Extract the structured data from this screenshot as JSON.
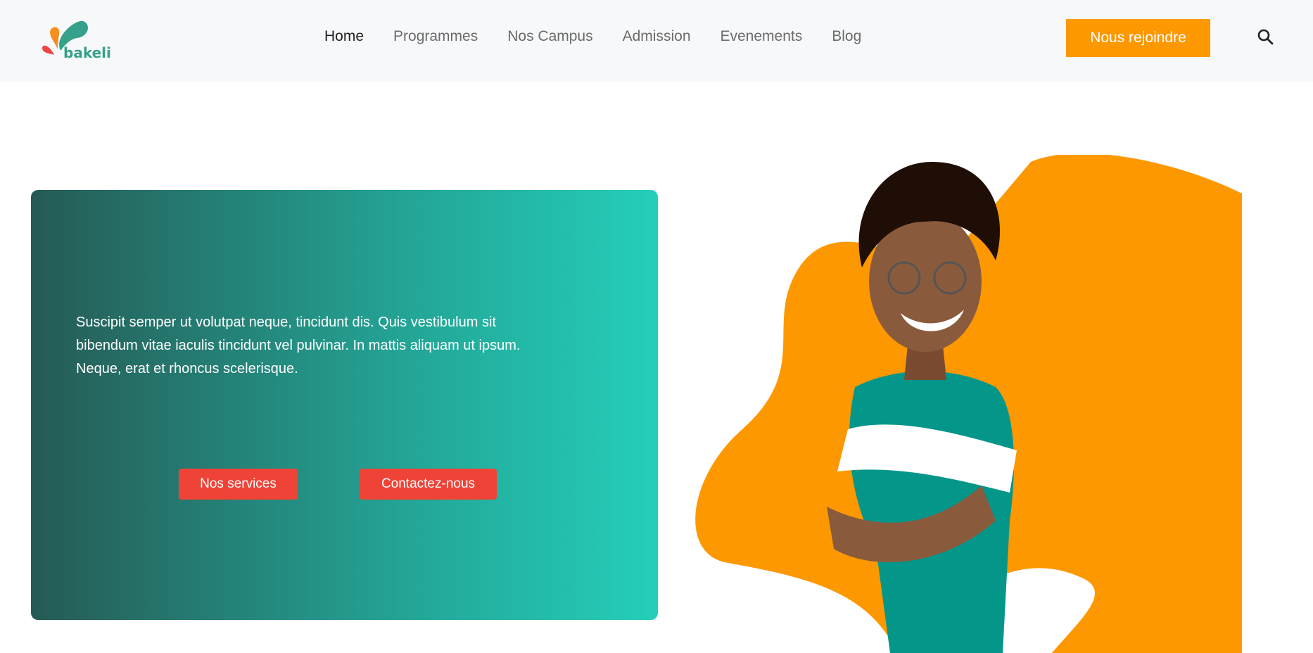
{
  "header": {
    "logo_text": "bakeli",
    "nav": [
      "Home",
      "Programmes",
      "Nos Campus",
      "Admission",
      "Evenements",
      "Blog"
    ],
    "active": "Home",
    "join_label": "Nous rejoindre",
    "search_icon": "search-icon"
  },
  "hero": {
    "text": "Suscipit semper ut volutpat neque, tincidunt dis. Quis vestibulum sit bibendum vitae iaculis tincidunt vel pulvinar. In mattis aliquam ut ipsum. Neque, erat et rhoncus scelerisque.",
    "buttons": [
      "Nos services",
      "Contactez-nous"
    ]
  },
  "colors": {
    "orange": "#fd9800",
    "teal": "#23a596",
    "red": "#ef4337"
  }
}
